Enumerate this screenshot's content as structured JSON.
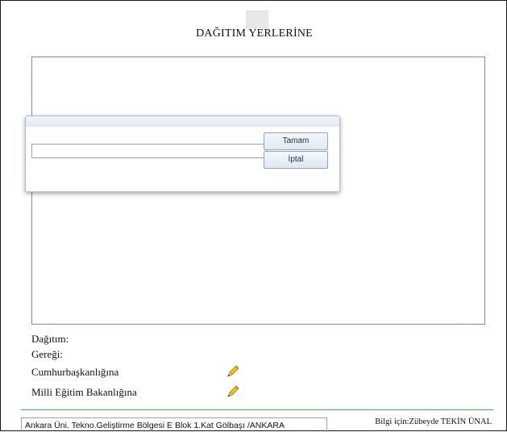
{
  "document": {
    "title": "DAĞITIM YERLERİNE"
  },
  "dialog": {
    "input_value": "",
    "ok_label": "Tamam",
    "cancel_label": "İptal"
  },
  "sections": {
    "dagitim_label": "Dağıtım:",
    "geregi_label": "Gereği:",
    "recipients": [
      {
        "label": "Cumhurbaşkanlığına",
        "icon": "pencil-icon"
      },
      {
        "label": "Milli Eğitim Bakanlığına",
        "icon": "pencil-icon"
      }
    ]
  },
  "footer": {
    "address": "Ankara Üni. Tekno.Geliştirme Bölgesi E Blok 1.Kat Gölbaşı /ANKARA",
    "info": "Bilgi için:Zübeyde TEKİN ÜNAL"
  },
  "colors": {
    "accent_border": "#8ea6c4",
    "separator_green": "#4caf50",
    "pencil_yellow": "#f0c419"
  }
}
